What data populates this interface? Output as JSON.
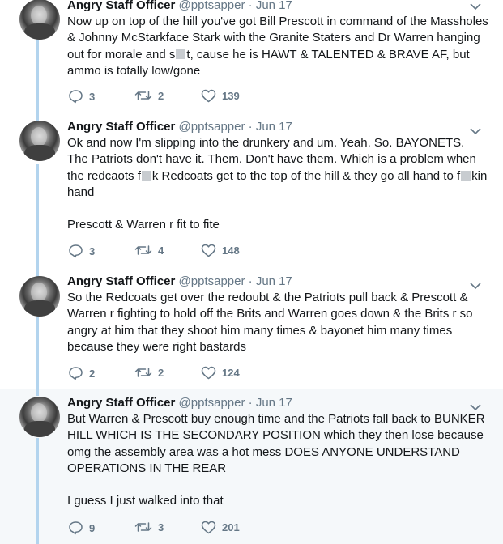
{
  "tweets": [
    {
      "name": "Angry Staff Officer",
      "handle": "@pptsapper",
      "date": "Jun 17",
      "text": [
        [
          "Now up on top of the hill you've got Bill Prescott in command of the Massholes & Johnny McStarkface Stark with the Granite Staters and Dr Warren hanging out for morale and s",
          "t, cause he is HAWT & TALENTED & BRAVE AF, but ammo is totally low/gone"
        ]
      ],
      "replies": "3",
      "retweets": "2",
      "likes": "139"
    },
    {
      "name": "Angry Staff Officer",
      "handle": "@pptsapper",
      "date": "Jun 17",
      "text": [
        [
          "Ok and now I'm slipping into the drunkery and um. Yeah. So. BAYONETS. The Patriots don't have it. Them. Don't have them. Which is a problem when the redcaots f",
          "k Redcoats get to the top of the hill & they go all hand to f",
          "kin hand"
        ],
        [
          "Prescott & Warren r fit to fite"
        ]
      ],
      "replies": "3",
      "retweets": "4",
      "likes": "148"
    },
    {
      "name": "Angry Staff Officer",
      "handle": "@pptsapper",
      "date": "Jun 17",
      "text": [
        [
          "So the Redcoats get over the redoubt & the Patriots pull back & Prescott & Warren r fighting to hold off the Brits and Warren goes down & the Brits r so angry at him that they shoot him many times & bayonet him many times because they were right bastards"
        ]
      ],
      "replies": "2",
      "retweets": "2",
      "likes": "124"
    },
    {
      "name": "Angry Staff Officer",
      "handle": "@pptsapper",
      "date": "Jun 17",
      "text": [
        [
          "But Warren & Prescott buy enough time and the Patriots fall back to BUNKER HILL WHICH IS THE SECONDARY POSITION which they then lose because omg the assembly area was a hot mess DOES ANYONE UNDERSTAND OPERATIONS IN THE REAR"
        ],
        [
          "I guess I just walked into that"
        ]
      ],
      "replies": "9",
      "retweets": "3",
      "likes": "201"
    }
  ],
  "separator": "·",
  "colors": {
    "thread_line": "#b3d4ee",
    "muted": "#657786",
    "highlight_bg": "#f5f8fa"
  }
}
